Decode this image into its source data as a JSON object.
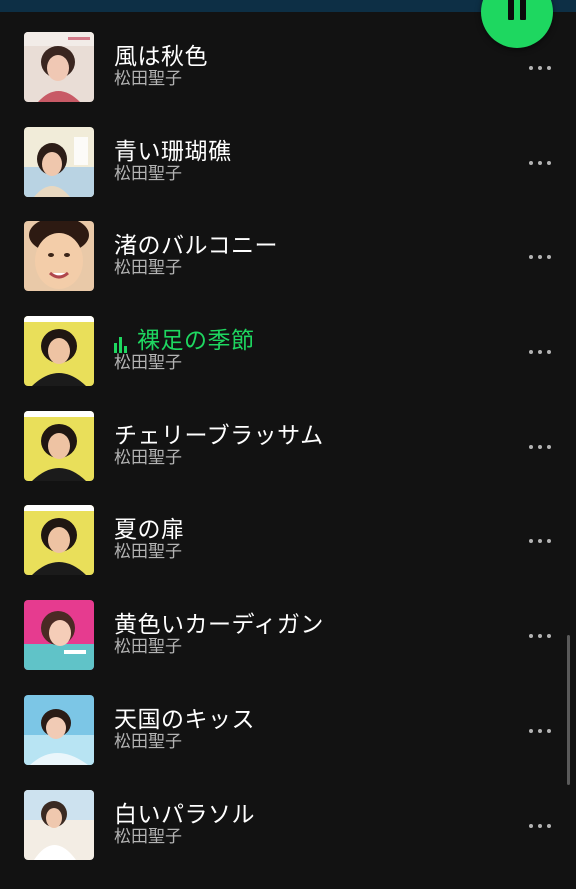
{
  "player": {
    "state": "playing",
    "control_icon": "pause-icon",
    "accent_color": "#1ed760"
  },
  "tracks": [
    {
      "title": "風は秋色",
      "artist": "松田聖子",
      "playing": false,
      "more_icon": "more-dots-icon"
    },
    {
      "title": "青い珊瑚礁",
      "artist": "松田聖子",
      "playing": false,
      "more_icon": "more-dots-icon"
    },
    {
      "title": "渚のバルコニー",
      "artist": "松田聖子",
      "playing": false,
      "more_icon": "more-dots-icon"
    },
    {
      "title": "裸足の季節",
      "artist": "松田聖子",
      "playing": true,
      "more_icon": "more-dots-icon"
    },
    {
      "title": "チェリーブラッサム",
      "artist": "松田聖子",
      "playing": false,
      "more_icon": "more-dots-icon"
    },
    {
      "title": "夏の扉",
      "artist": "松田聖子",
      "playing": false,
      "more_icon": "more-dots-icon"
    },
    {
      "title": "黄色いカーディガン",
      "artist": "松田聖子",
      "playing": false,
      "more_icon": "more-dots-icon"
    },
    {
      "title": "天国のキッス",
      "artist": "松田聖子",
      "playing": false,
      "more_icon": "more-dots-icon"
    },
    {
      "title": "白いパラソル",
      "artist": "松田聖子",
      "playing": false,
      "more_icon": "more-dots-icon"
    }
  ]
}
